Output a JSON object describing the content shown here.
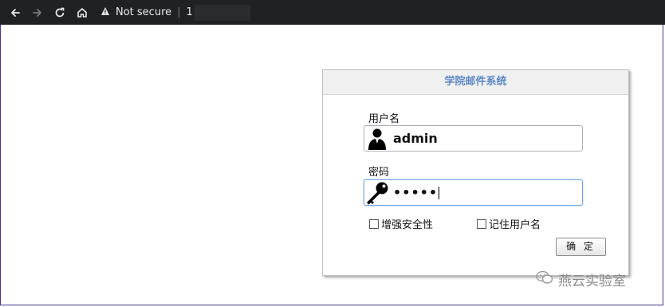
{
  "browser": {
    "security_label": "Not secure",
    "url_prefix": "1"
  },
  "login": {
    "title": "学院邮件系统",
    "username_label": "用户名",
    "username_value": "admin",
    "password_label": "密码",
    "password_value": "•••••",
    "option_enhanced_security": "增强安全性",
    "option_remember_user": "记住用户名",
    "submit_label": "确 定"
  },
  "watermark": {
    "text": "燕云实验室"
  }
}
